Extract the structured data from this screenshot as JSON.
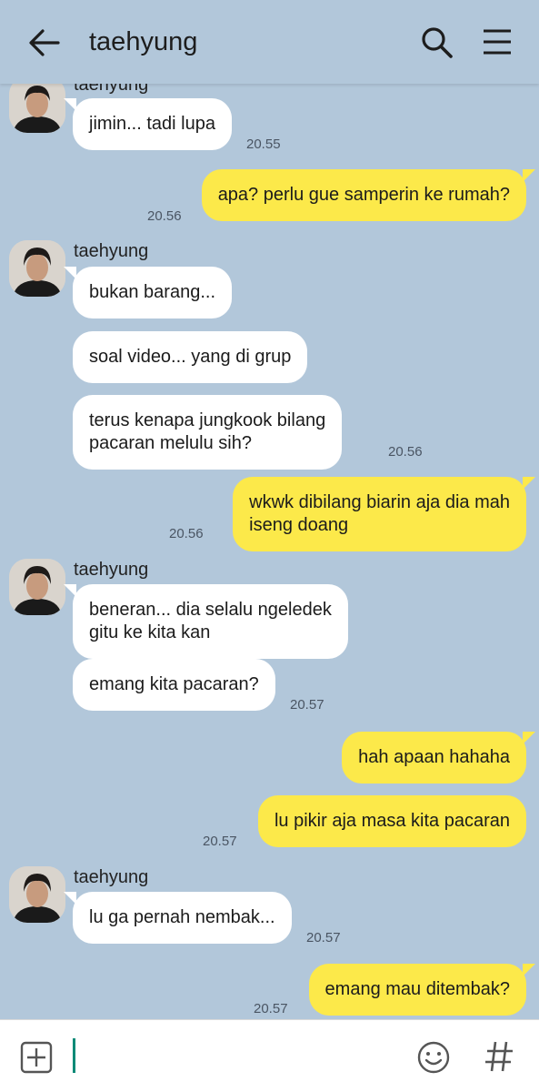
{
  "header": {
    "back_icon": "arrow-left-icon",
    "title": "taehyung",
    "search_icon": "search-icon",
    "menu_icon": "hamburger-menu-icon"
  },
  "messages": [
    {
      "sender": "taehyung",
      "dir": "in",
      "text": "jimin... tadi lupa",
      "time": "20.55"
    },
    {
      "sender": "me",
      "dir": "out",
      "text": "apa? perlu gue samperin ke rumah?",
      "time": "20.56"
    },
    {
      "sender": "taehyung",
      "dir": "in",
      "text": "bukan barang...",
      "time": ""
    },
    {
      "sender": "taehyung",
      "dir": "in",
      "text": "soal video... yang di grup",
      "time": ""
    },
    {
      "sender": "taehyung",
      "dir": "in",
      "text": "terus kenapa jungkook bilang\npacaran melulu sih?",
      "time": "20.56"
    },
    {
      "sender": "me",
      "dir": "out",
      "text": "wkwk dibilang biarin aja dia mah\niseng doang",
      "time": "20.56"
    },
    {
      "sender": "taehyung",
      "dir": "in",
      "text": "beneran... dia selalu ngeledek\ngitu ke kita kan",
      "time": ""
    },
    {
      "sender": "taehyung",
      "dir": "in",
      "text": "emang kita pacaran?",
      "time": "20.57"
    },
    {
      "sender": "me",
      "dir": "out",
      "text": "hah apaan hahaha",
      "time": ""
    },
    {
      "sender": "me",
      "dir": "out",
      "text": "lu pikir aja masa kita pacaran",
      "time": "20.57"
    },
    {
      "sender": "taehyung",
      "dir": "in",
      "text": "lu ga pernah nembak...",
      "time": "20.57"
    },
    {
      "sender": "me",
      "dir": "out",
      "text": "emang mau ditembak?",
      "time": "20.57"
    }
  ],
  "sender_labels": [
    "taehyung",
    "taehyung",
    "taehyung",
    "taehyung"
  ],
  "composer": {
    "attach_icon": "plus-box-icon",
    "emoji_icon": "smiley-icon",
    "hashtag_icon": "hashtag-icon"
  },
  "colors": {
    "background": "#b2c7da",
    "outgoing_bubble": "#fce94a",
    "incoming_bubble": "#ffffff",
    "caret": "#0a8a77"
  }
}
